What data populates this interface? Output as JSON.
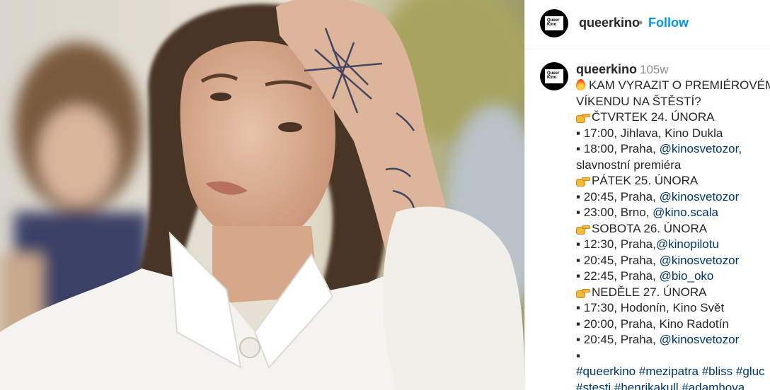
{
  "post": {
    "username": "queerkino",
    "separator": "•",
    "follow_label": "Follow",
    "avatar_text": "Queer Kino"
  },
  "caption": {
    "username": "queerkino",
    "age": "105w",
    "lines": [
      {
        "icon": "flame",
        "parts": [
          {
            "t": "KAM VYRAZIT O PREMIÉROVÉM"
          }
        ]
      },
      {
        "parts": [
          {
            "t": "VÍKENDU NA ŠTĚSTÍ?"
          }
        ]
      },
      {
        "icon": "hand",
        "parts": [
          {
            "t": "ČTVRTEK 24. ÚNORA"
          }
        ]
      },
      {
        "parts": [
          {
            "t": "▪ 17:00, Jihlava, Kino Dukla"
          }
        ]
      },
      {
        "parts": [
          {
            "t": "▪ 18:00, Praha, "
          },
          {
            "t": "@kinosvetozor",
            "k": "mention"
          },
          {
            "t": ","
          }
        ]
      },
      {
        "parts": [
          {
            "t": "slavnostní premiéra"
          }
        ]
      },
      {
        "icon": "hand",
        "parts": [
          {
            "t": "PÁTEK 25. ÚNORA"
          }
        ]
      },
      {
        "parts": [
          {
            "t": "▪ 20:45, Praha, "
          },
          {
            "t": "@kinosvetozor",
            "k": "mention"
          }
        ]
      },
      {
        "parts": [
          {
            "t": "▪ 23:00, Brno, "
          },
          {
            "t": "@kino.scala",
            "k": "mention"
          }
        ]
      },
      {
        "icon": "hand",
        "parts": [
          {
            "t": "SOBOTA 26. ÚNORA"
          }
        ]
      },
      {
        "parts": [
          {
            "t": "▪ 12:30, Praha,"
          },
          {
            "t": "@kinopilotu",
            "k": "mention"
          }
        ]
      },
      {
        "parts": [
          {
            "t": "▪ 20:45, Praha, "
          },
          {
            "t": "@kinosvetozor",
            "k": "mention"
          }
        ]
      },
      {
        "parts": [
          {
            "t": "▪ 22:45, Praha, "
          },
          {
            "t": "@bio_oko",
            "k": "mention"
          }
        ]
      },
      {
        "icon": "hand",
        "parts": [
          {
            "t": "NEDĚLE 27. ÚNORA"
          }
        ]
      },
      {
        "parts": [
          {
            "t": "▪ 17:30, Hodonín, Kino Svět"
          }
        ]
      },
      {
        "parts": [
          {
            "t": "▪ 20:00, Praha, Kino Radotín"
          }
        ]
      },
      {
        "parts": [
          {
            "t": "▪ 20:45, Praha, "
          },
          {
            "t": "@kinosvetozor",
            "k": "mention"
          }
        ]
      },
      {
        "parts": [
          {
            "t": "▪"
          }
        ]
      },
      {
        "parts": [
          {
            "t": "#queerkino",
            "k": "tag"
          },
          {
            "t": " "
          },
          {
            "t": "#mezipatra",
            "k": "tag"
          },
          {
            "t": " "
          },
          {
            "t": "#bliss",
            "k": "tag"
          },
          {
            "t": " "
          },
          {
            "t": "#gluc",
            "k": "tag"
          }
        ]
      },
      {
        "parts": [
          {
            "t": "#stesti",
            "k": "tag"
          },
          {
            "t": " "
          },
          {
            "t": "#henrikakull",
            "k": "tag"
          },
          {
            "t": " "
          },
          {
            "t": "#adamhova",
            "k": "tag"
          }
        ]
      }
    ]
  }
}
